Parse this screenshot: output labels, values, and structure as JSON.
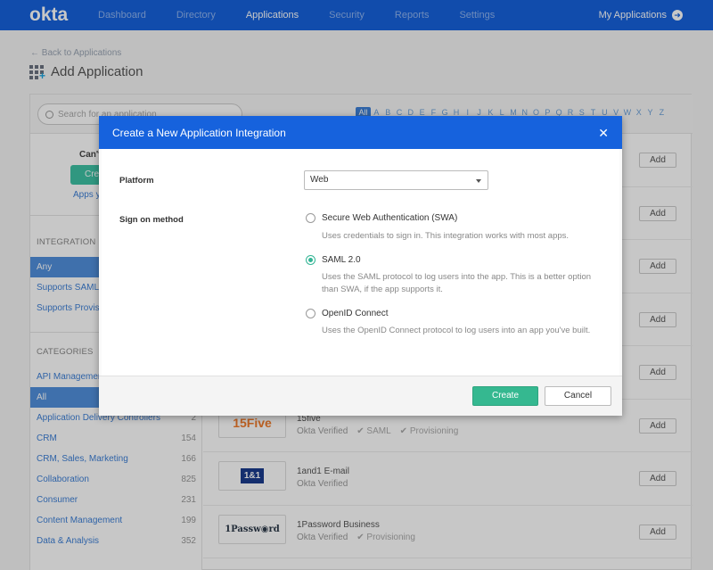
{
  "nav": {
    "logo": "okta",
    "links": [
      "Dashboard",
      "Directory",
      "Applications",
      "Security",
      "Reports",
      "Settings"
    ],
    "active": "Applications",
    "my_apps": "My Applications"
  },
  "page": {
    "back_link": "← Back to Applications",
    "title": "Add Application"
  },
  "search": {
    "placeholder": "Search for an application"
  },
  "alphabet": [
    "All",
    "A",
    "B",
    "C",
    "D",
    "E",
    "F",
    "G",
    "H",
    "I",
    "J",
    "K",
    "L",
    "M",
    "N",
    "O",
    "P",
    "Q",
    "R",
    "S",
    "T",
    "U",
    "V",
    "W",
    "X",
    "Y",
    "Z"
  ],
  "sidebar": {
    "promo_title": "Can't",
    "promo_button": "Cre",
    "promo_link": "Apps y",
    "integration_heading": "INTEGRATION PR",
    "integration_items": [
      "Any",
      "Supports SAML",
      "Supports Provisi"
    ],
    "categories_heading": "CATEGORIES",
    "categories": [
      {
        "label": "API Management",
        "count": ""
      },
      {
        "label": "All",
        "count": ""
      },
      {
        "label": "Application Delivery Controllers",
        "count": "2"
      },
      {
        "label": "CRM",
        "count": "154"
      },
      {
        "label": "CRM, Sales, Marketing",
        "count": "166"
      },
      {
        "label": "Collaboration",
        "count": "825"
      },
      {
        "label": "Consumer",
        "count": "231"
      },
      {
        "label": "Content Management",
        "count": "199"
      },
      {
        "label": "Data & Analysis",
        "count": "352"
      }
    ]
  },
  "apps": {
    "add_label": "Add",
    "rows": [
      {
        "name": "15five",
        "verified": "Okta Verified",
        "saml": "✔ SAML",
        "prov": "✔ Provisioning",
        "logo_text": "15Five"
      },
      {
        "name": "1and1 E-mail",
        "verified": "Okta Verified",
        "saml": "",
        "prov": "",
        "logo_text": "1&1"
      },
      {
        "name": "1Password Business",
        "verified": "Okta Verified",
        "saml": "✔ Provisioning",
        "prov": "",
        "logo_text": "1Passw◉rd"
      }
    ]
  },
  "modal": {
    "title": "Create a New Application Integration",
    "close": "✕",
    "platform_label": "Platform",
    "platform_value": "Web",
    "signon_label": "Sign on method",
    "options": [
      {
        "label": "Secure Web Authentication (SWA)",
        "desc": "Uses credentials to sign in. This integration works with most apps."
      },
      {
        "label": "SAML 2.0",
        "desc": "Uses the SAML protocol to log users into the app. This is a better option than SWA, if the app supports it."
      },
      {
        "label": "OpenID Connect",
        "desc": "Uses the OpenID Connect protocol to log users into an app you've built."
      }
    ],
    "selected_option": "SAML 2.0",
    "create_label": "Create",
    "cancel_label": "Cancel"
  }
}
